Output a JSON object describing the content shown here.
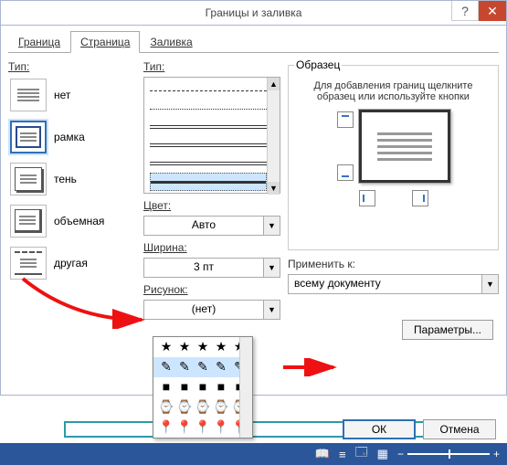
{
  "title": "Границы и заливка",
  "tabs": {
    "border": "Граница",
    "page": "Страница",
    "fill": "Заливка"
  },
  "labels": {
    "type": "Тип:",
    "type2": "Тип:",
    "color": "Цвет:",
    "width": "Ширина:",
    "art": "Рисунок:",
    "sample": "Образец",
    "sample_hint": "Для добавления границ щелкните образец или используйте кнопки",
    "apply_to": "Применить к:"
  },
  "types": {
    "none": "нет",
    "box": "рамка",
    "shadow": "тень",
    "threeD": "объемная",
    "custom": "другая"
  },
  "color_value": "Авто",
  "width_value": "3 пт",
  "art_value": "(нет)",
  "apply_value": "всему документу",
  "buttons": {
    "params": "Параметры...",
    "ok": "ОК",
    "cancel": "Отмена"
  },
  "art_dropdown": {
    "rows": [
      {
        "glyph": "★",
        "selected": false
      },
      {
        "glyph": "✎",
        "selected": true
      },
      {
        "glyph": "■",
        "selected": false
      },
      {
        "glyph": "⌚",
        "selected": false
      },
      {
        "glyph": "📍",
        "selected": false
      }
    ]
  },
  "statusbar": {
    "icons": [
      "📖",
      "≡",
      "🗔",
      "▦"
    ],
    "minus": "−",
    "plus": "+"
  }
}
